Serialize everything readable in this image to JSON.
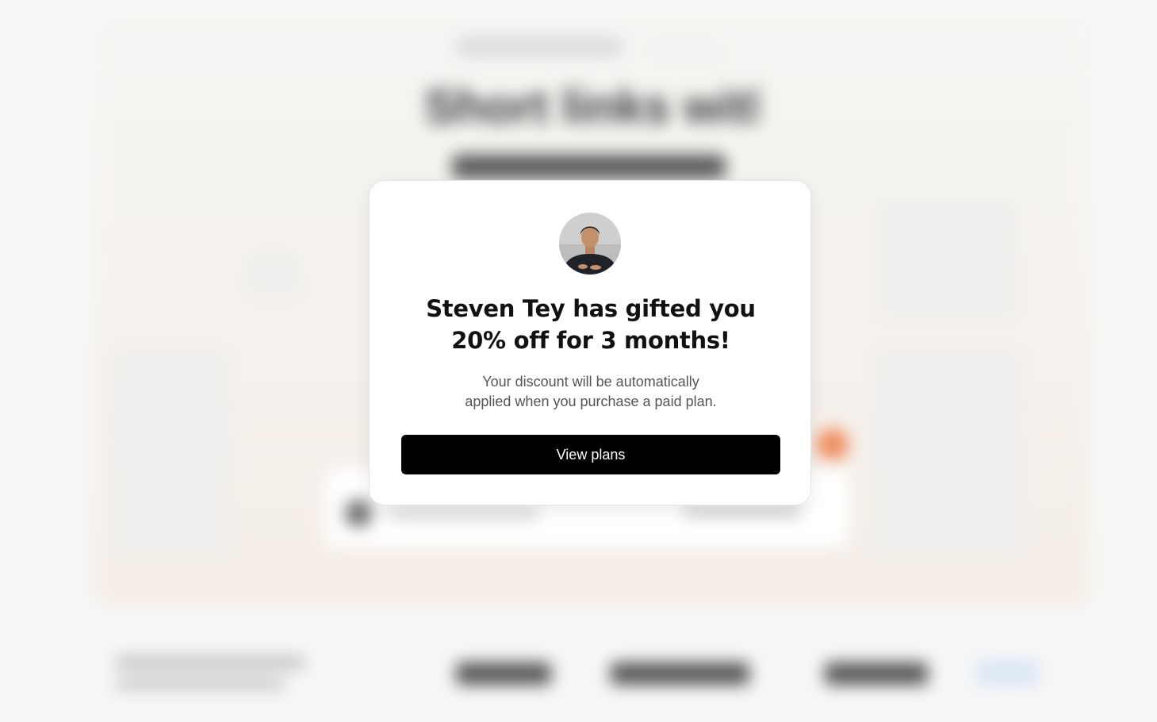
{
  "background": {
    "headline_fragment": "Short links with"
  },
  "modal": {
    "title_line1": "Steven Tey has gifted you",
    "title_line2": "20% off for 3 months!",
    "description_line1": "Your discount will be automatically",
    "description_line2": "applied when you purchase a paid plan.",
    "cta_label": "View plans",
    "avatar_icon": "person-photo",
    "colors": {
      "button_bg": "#000000",
      "button_text": "#ffffff",
      "title": "#111111",
      "description": "#555555"
    }
  }
}
